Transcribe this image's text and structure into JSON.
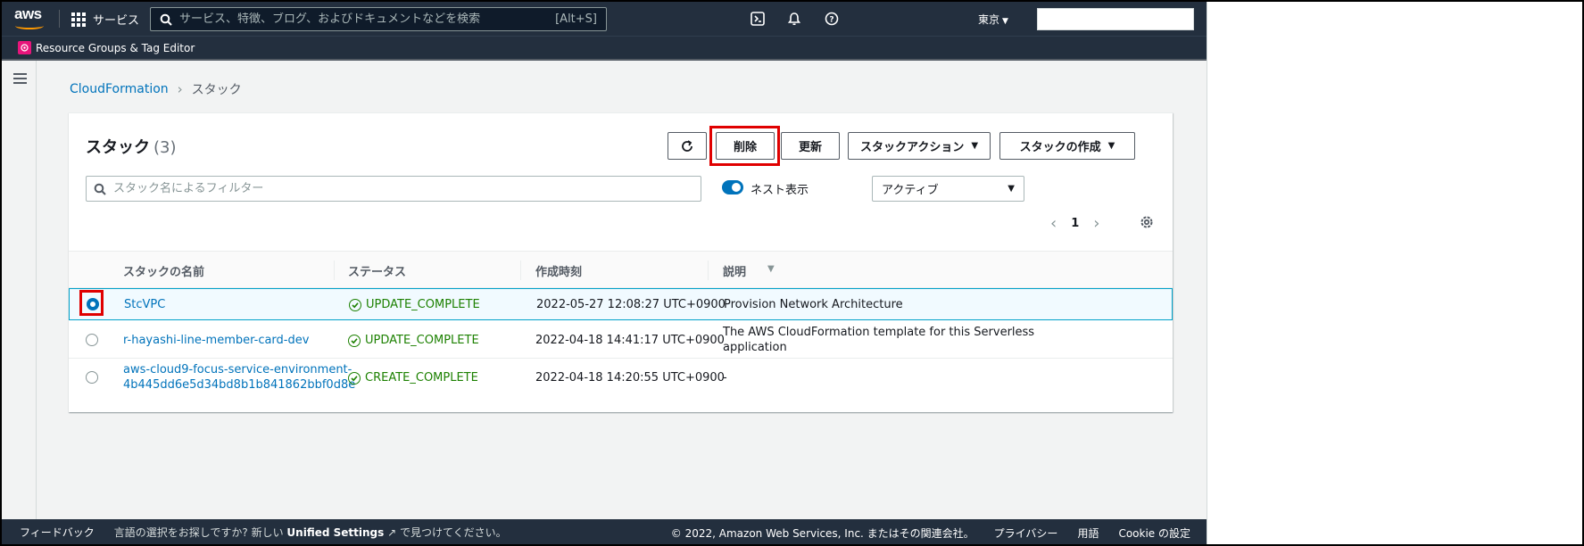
{
  "topnav": {
    "logo_text": "aws",
    "services_label": "サービス",
    "search_placeholder": "サービス、特徴、ブログ、およびドキュメントなどを検索",
    "search_shortcut": "[Alt+S]",
    "region": "東京",
    "icons": [
      "terminal-icon",
      "bell-icon",
      "help-icon"
    ]
  },
  "favorites": {
    "label": "Resource Groups & Tag Editor"
  },
  "breadcrumb": {
    "root": "CloudFormation",
    "current": "スタック"
  },
  "panel": {
    "title": "スタック",
    "count": "(3)",
    "buttons": {
      "delete": "削除",
      "update": "更新",
      "stack_actions": "スタックアクション",
      "create_stack": "スタックの作成"
    },
    "filter_placeholder": "スタック名によるフィルター",
    "nest_toggle_label": "ネスト表示",
    "status_filter": "アクティブ",
    "page": "1"
  },
  "table": {
    "headers": {
      "name": "スタックの名前",
      "status": "ステータス",
      "created": "作成時刻",
      "description": "説明"
    },
    "rows": [
      {
        "name_line1": "StcVPC",
        "name_line2": "",
        "status": "UPDATE_COMPLETE",
        "created": "2022-05-27 12:08:27 UTC+0900",
        "desc_line1": "Provision Network Architecture",
        "desc_line2": "",
        "selected": true
      },
      {
        "name_line1": "r-hayashi-line-member-card-dev",
        "name_line2": "",
        "status": "UPDATE_COMPLETE",
        "created": "2022-04-18 14:41:17 UTC+0900",
        "desc_line1": "The AWS CloudFormation template for this Serverless",
        "desc_line2": "application",
        "selected": false
      },
      {
        "name_line1": "aws-cloud9-focus-service-environment-",
        "name_line2": "4b445dd6e5d34bd8b1b841862bbf0d8e",
        "status": "CREATE_COMPLETE",
        "created": "2022-04-18 14:20:55 UTC+0900",
        "desc_line1": "-",
        "desc_line2": "",
        "selected": false
      }
    ]
  },
  "footer": {
    "feedback": "フィードバック",
    "msg_before": "言語の選択をお探しですか? 新しい",
    "msg_link": "Unified Settings",
    "msg_after": "で見つけてください。",
    "copyright": "© 2022, Amazon Web Services, Inc. またはその関連会社。",
    "privacy": "プライバシー",
    "terms": "用語",
    "cookie": "Cookie の設定"
  },
  "colors": {
    "nav_bg": "#232f3e",
    "link": "#0073bb",
    "success": "#1d8102",
    "highlight": "#e00000"
  }
}
